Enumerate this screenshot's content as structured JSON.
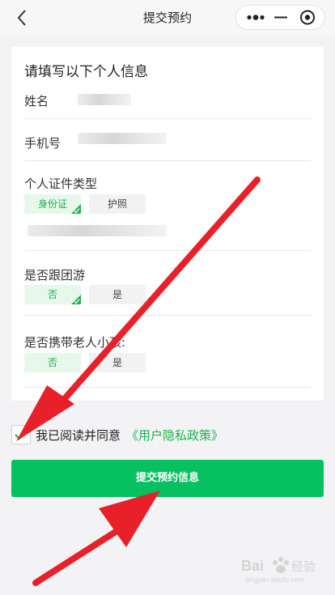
{
  "navbar": {
    "title": "提交预约",
    "back_icon": "chevron-left-icon",
    "capsule": {
      "more_icon": "more-dots-icon",
      "minimize_icon": "minimize-icon",
      "close_icon": "target-circle-icon"
    }
  },
  "form": {
    "section_title": "请填写以下个人信息",
    "name_label": "姓名",
    "phone_label": "手机号",
    "id_type_label": "个人证件类型",
    "id_type_options": [
      {
        "label": "身份证",
        "selected": true
      },
      {
        "label": "护照",
        "selected": false
      }
    ],
    "group_tour_label": "是否跟团游",
    "group_tour_options": [
      {
        "label": "否",
        "selected": true
      },
      {
        "label": "是",
        "selected": false
      }
    ],
    "elder_child_label": "是否携带老人小孩:",
    "elder_child_options": [
      {
        "label": "否",
        "selected": true
      },
      {
        "label": "是",
        "selected": false
      }
    ]
  },
  "agreement": {
    "checked": true,
    "text": "我已阅读并同意",
    "policy_link": "《用户隐私政策》"
  },
  "submit": {
    "label": "提交预约信息"
  },
  "colors": {
    "accent": "#07c160",
    "selected_text": "#1ab34a",
    "annotation_arrow": "#e8202a"
  },
  "watermark": {
    "text": "Bai 经验",
    "subtext": "jingyan.baidu.com"
  }
}
